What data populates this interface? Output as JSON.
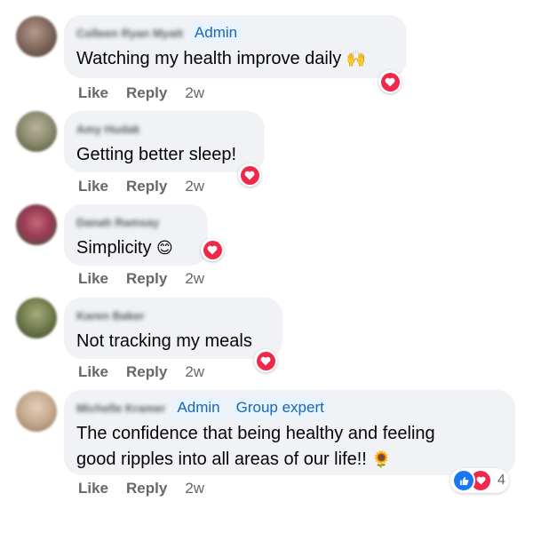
{
  "comments": [
    {
      "author": "Colleen Ryan Myatt",
      "badges": [
        "Admin"
      ],
      "text": "Watching my health improve daily",
      "emoji": "🙌",
      "avatar_color": "#7a6258",
      "actions": {
        "like": "Like",
        "reply": "Reply",
        "time": "2w"
      },
      "reaction": "love"
    },
    {
      "author": "Amy Hudak",
      "badges": [],
      "text": "Getting better sleep!",
      "emoji": "",
      "avatar_color": "#8a8a6e",
      "actions": {
        "like": "Like",
        "reply": "Reply",
        "time": "2w"
      },
      "reaction": "love"
    },
    {
      "author": "Danah Ramsay",
      "badges": [],
      "text": "Simplicity",
      "emoji": "😊",
      "avatar_color": "#9b3b55",
      "actions": {
        "like": "Like",
        "reply": "Reply",
        "time": "2w"
      },
      "reaction": "love"
    },
    {
      "author": "Karen Baker",
      "badges": [],
      "text": "Not tracking my meals",
      "emoji": "",
      "avatar_color": "#6f7a4a",
      "actions": {
        "like": "Like",
        "reply": "Reply",
        "time": "2w"
      },
      "reaction": "love"
    },
    {
      "author": "Michelle Kramer",
      "badges": [
        "Admin",
        "Group expert"
      ],
      "text_line1": "The confidence that being healthy and feeling",
      "text_line2": "good ripples into all areas of our life!!",
      "emoji": "🌻",
      "avatar_color": "#c4a98c",
      "actions": {
        "like": "Like",
        "reply": "Reply",
        "time": "2w"
      },
      "reactions": [
        "like",
        "love"
      ],
      "reaction_count": "4"
    }
  ],
  "colors": {
    "bubble": "#f0f2f5",
    "badge_bg": "#e7f3ff",
    "badge_text": "#1b66b5",
    "love": "#f0284a",
    "like": "#1877f2",
    "meta_text": "#65676b"
  }
}
